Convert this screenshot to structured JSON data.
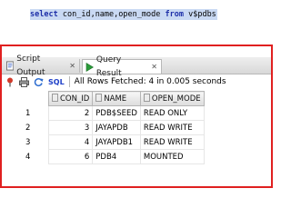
{
  "editor": {
    "sql": {
      "select": "select",
      "columns_1": "con_id",
      "comma_1": ",",
      "columns_2": "name",
      "comma_2": ",",
      "columns_3": "open_mode",
      "from": "from",
      "table": "v$pdbs"
    }
  },
  "tabs": [
    {
      "label": "Script Output",
      "icon": "script-doc-icon"
    },
    {
      "label": "Query Result",
      "icon": "play-icon"
    }
  ],
  "toolbar": {
    "sql_label": "SQL",
    "status": "All Rows Fetched: 4 in 0.005 seconds"
  },
  "results": {
    "columns": [
      "CON_ID",
      "NAME",
      "OPEN_MODE"
    ],
    "rows": [
      {
        "num": "1",
        "con_id": "2",
        "name": "PDB$SEED",
        "open_mode": "READ ONLY"
      },
      {
        "num": "2",
        "con_id": "3",
        "name": "JAYAPDB",
        "open_mode": "READ WRITE"
      },
      {
        "num": "3",
        "con_id": "4",
        "name": "JAYAPDB1",
        "open_mode": "READ WRITE"
      },
      {
        "num": "4",
        "con_id": "6",
        "name": "PDB4",
        "open_mode": "MOUNTED"
      }
    ]
  },
  "colors": {
    "highlight": "#e02020",
    "keyword": "#1d2fa8",
    "selection": "#c9d9f3"
  }
}
